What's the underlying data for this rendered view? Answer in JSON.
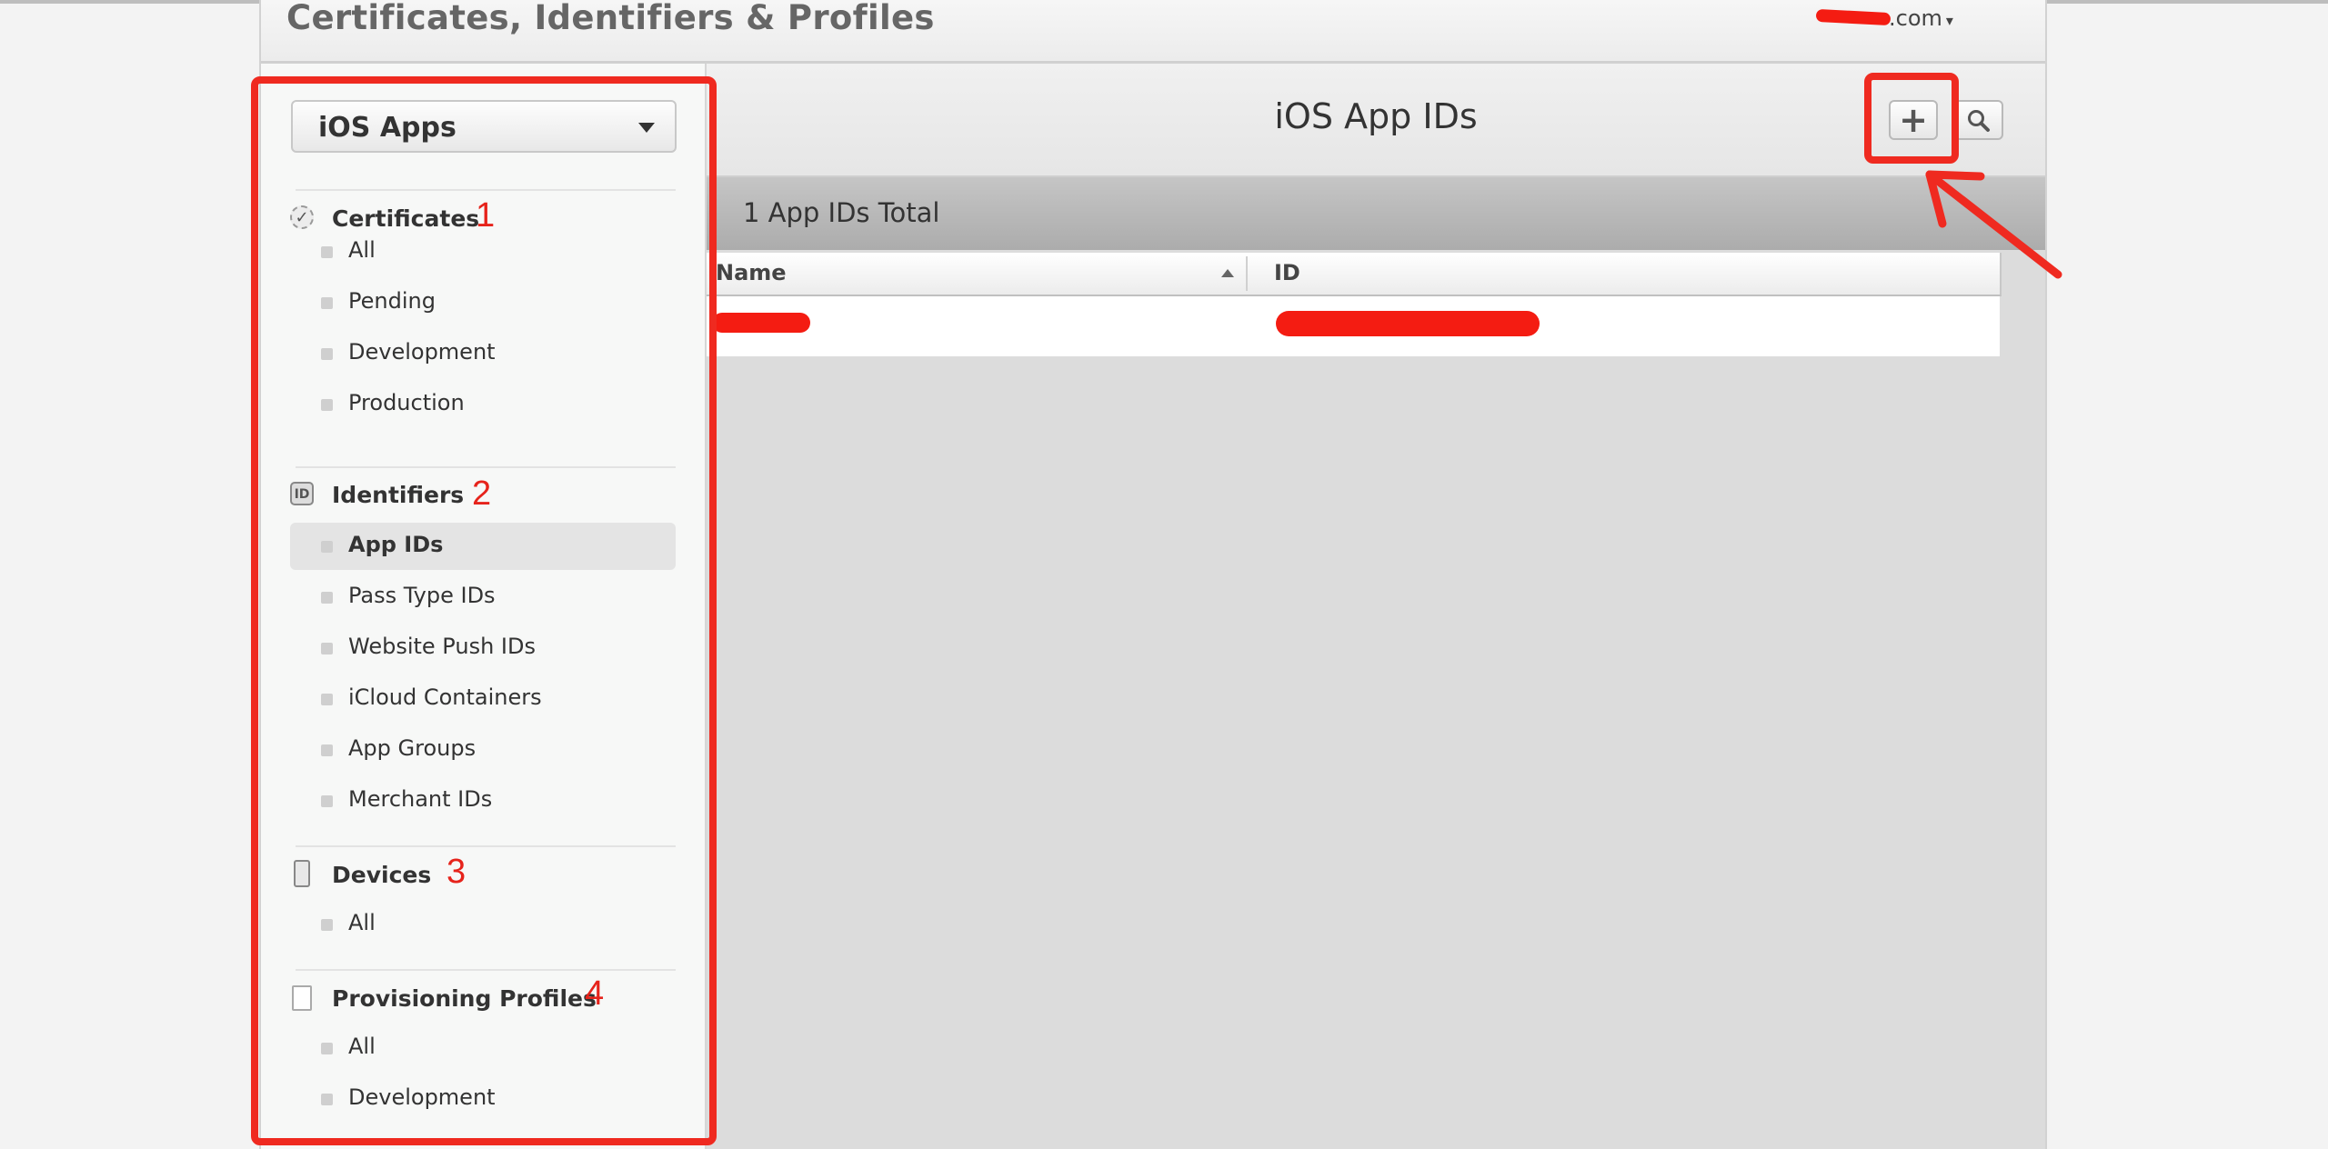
{
  "header": {
    "title": "Certificates, Identifiers & Profiles",
    "account_suffix": ".com",
    "account_caret": "▾"
  },
  "sidebar": {
    "platform_selector": "iOS Apps",
    "sections": [
      {
        "name": "Certificates",
        "icon": "certificate-icon",
        "annotation": "1",
        "items": [
          "All",
          "Pending",
          "Development",
          "Production"
        ]
      },
      {
        "name": "Identifiers",
        "icon": "id-icon",
        "icon_text": "ID",
        "annotation": "2",
        "items": [
          "App IDs",
          "Pass Type IDs",
          "Website Push IDs",
          "iCloud Containers",
          "App Groups",
          "Merchant IDs"
        ],
        "selected": "App IDs"
      },
      {
        "name": "Devices",
        "icon": "device-icon",
        "annotation": "3",
        "items": [
          "All"
        ]
      },
      {
        "name": "Provisioning Profiles",
        "icon": "document-icon",
        "annotation": "4",
        "items": [
          "All",
          "Development"
        ]
      }
    ]
  },
  "main": {
    "heading": "iOS App IDs",
    "add_button": "+",
    "search_icon": "⌕",
    "total": "1 App IDs Total",
    "columns": [
      "Name",
      "ID"
    ]
  },
  "colors": {
    "annotation_red": "#ef2a20",
    "sidebar_bg": "#f7f8f7",
    "band_bg": "#b4b4b4"
  }
}
